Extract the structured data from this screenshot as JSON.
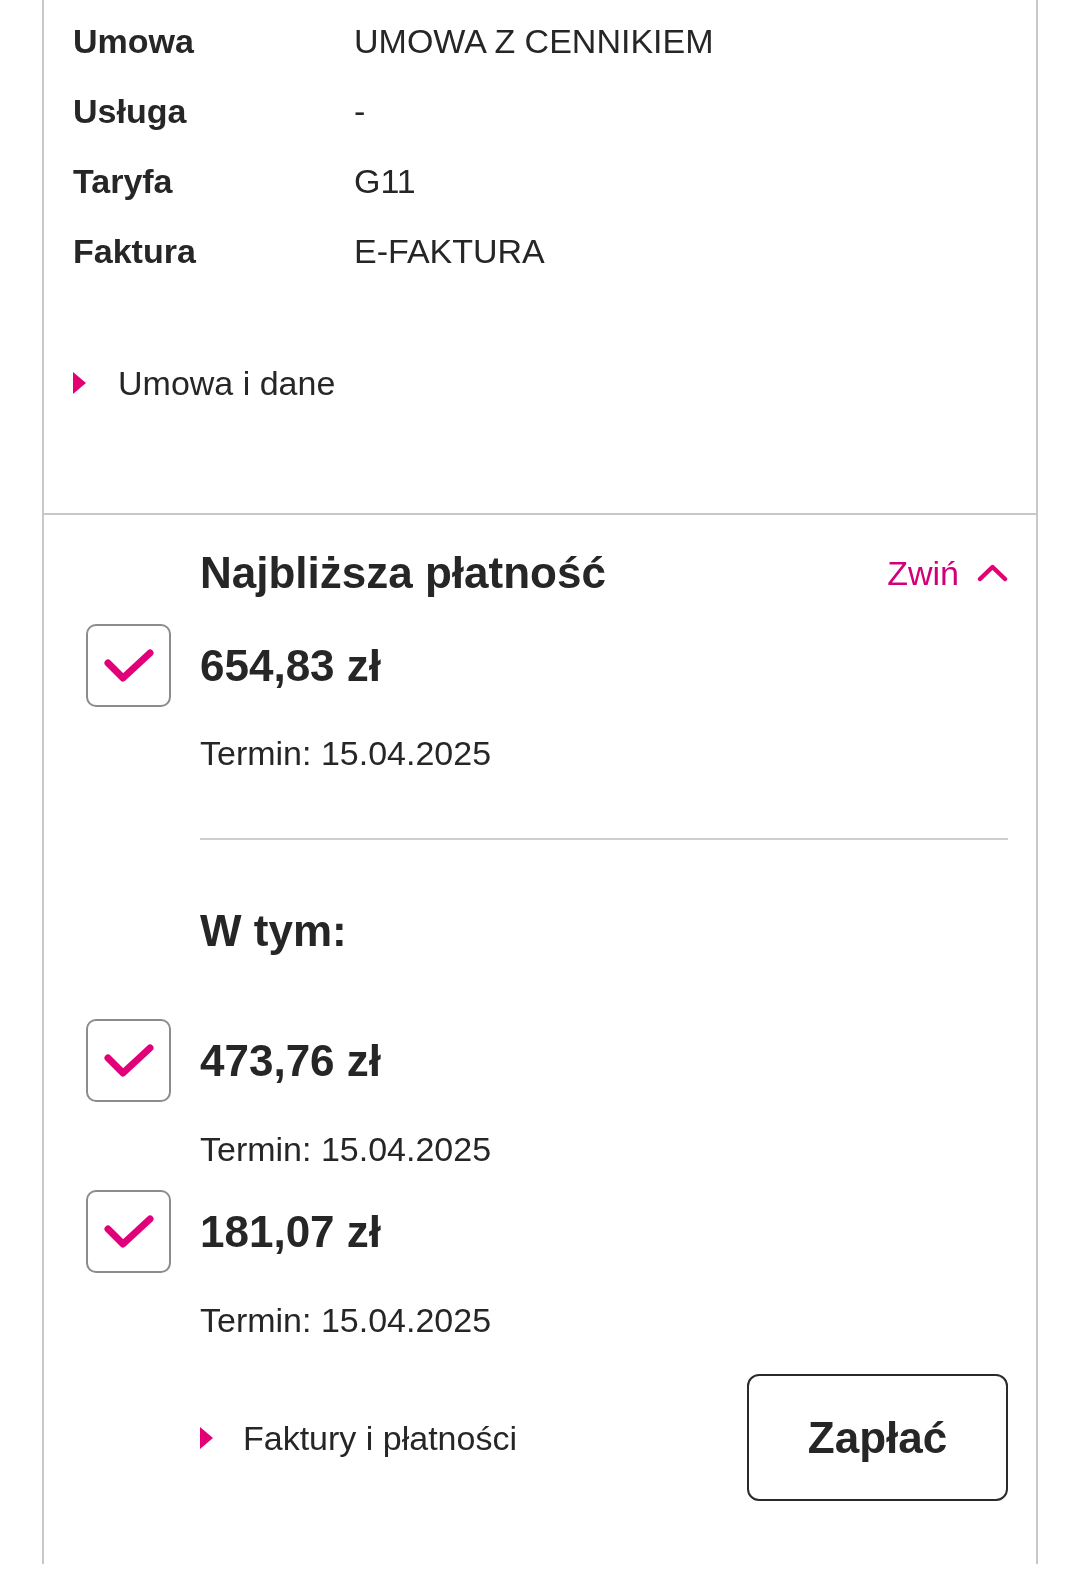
{
  "contract_details": [
    {
      "label": "Umowa",
      "value": "UMOWA Z CENNIKIEM"
    },
    {
      "label": "Usługa",
      "value": "-"
    },
    {
      "label": "Taryfa",
      "value": "G11"
    },
    {
      "label": "Faktura",
      "value": "E-FAKTURA"
    }
  ],
  "contract_link": {
    "label": "Umowa i dane"
  },
  "next_payment": {
    "title": "Najbliższa płatność",
    "toggle": {
      "label": "Zwiń",
      "expanded": true
    },
    "total": {
      "amount": "654,83 zł",
      "due": "Termin: 15.04.2025",
      "checked": true
    },
    "breakdown_title": "W tym:",
    "items": [
      {
        "amount": "473,76 zł",
        "due": "Termin: 15.04.2025",
        "checked": true
      },
      {
        "amount": "181,07 zł",
        "due": "Termin: 15.04.2025",
        "checked": true
      }
    ],
    "link": {
      "label": "Faktury i płatności"
    },
    "pay_button": {
      "label": "Zapłać"
    }
  }
}
